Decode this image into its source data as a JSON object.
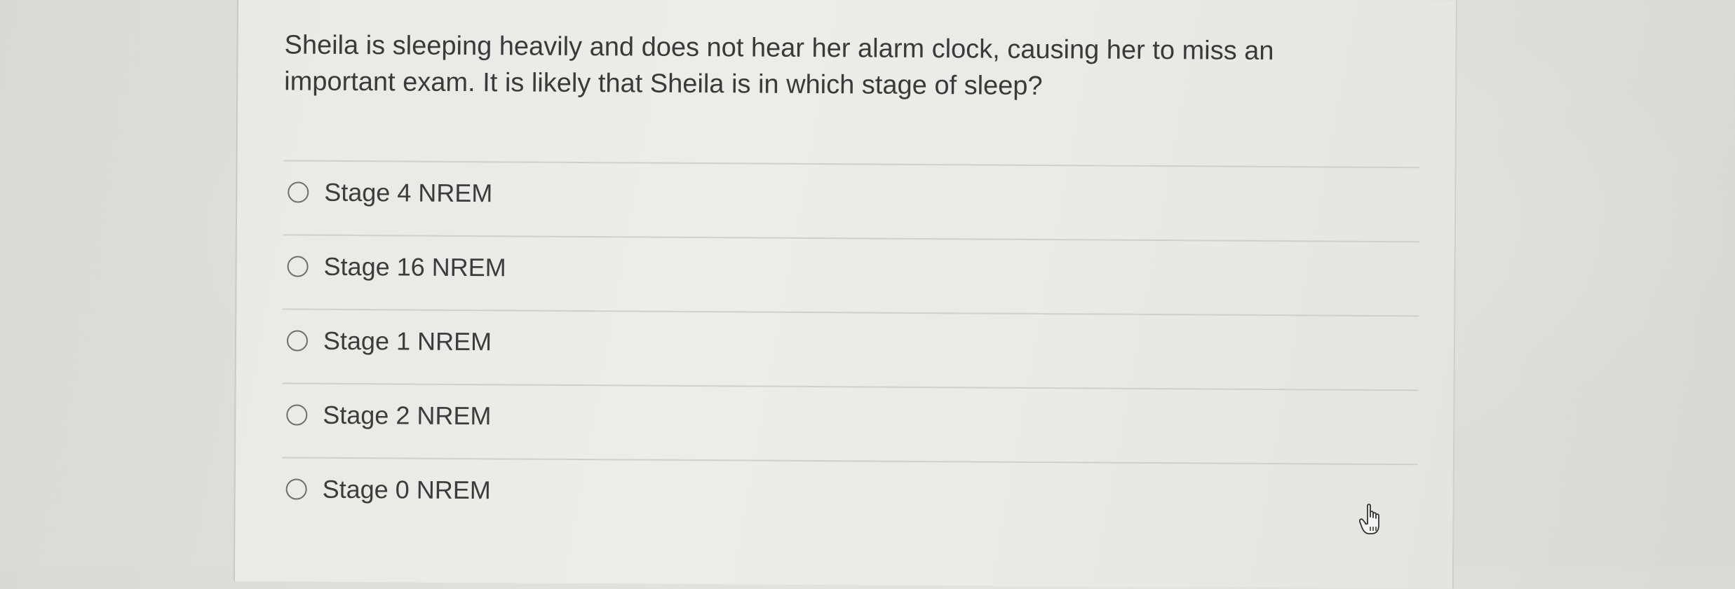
{
  "question": {
    "text": "Sheila is sleeping heavily and does not hear her alarm clock, causing her to miss an important exam. It is likely that Sheila is in which stage of sleep?"
  },
  "options": [
    {
      "label": "Stage 4 NREM",
      "selected": false
    },
    {
      "label": "Stage 16 NREM",
      "selected": false
    },
    {
      "label": "Stage 1 NREM",
      "selected": false
    },
    {
      "label": "Stage 2 NREM",
      "selected": false
    },
    {
      "label": "Stage 0 NREM",
      "selected": false
    }
  ],
  "pointer": {
    "icon": "hand-pointer-icon"
  }
}
